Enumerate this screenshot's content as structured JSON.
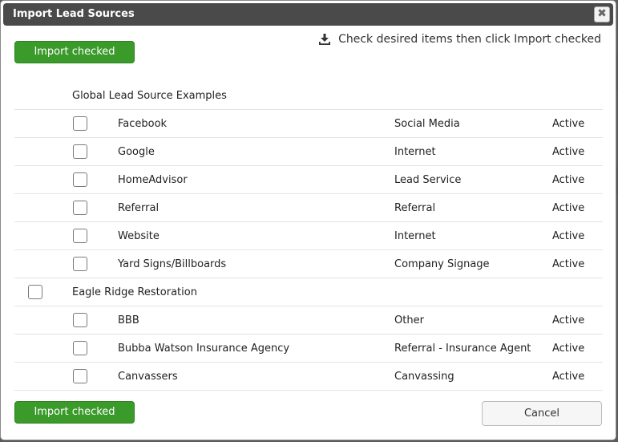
{
  "dialog": {
    "title": "Import Lead Sources",
    "close_label": "✖",
    "hint": "Check desired items then click Import checked",
    "import_label": "Import checked",
    "cancel_label": "Cancel"
  },
  "groups": [
    {
      "name": "Global Lead Source Examples",
      "has_checkbox": false,
      "items": [
        {
          "name": "Facebook",
          "type": "Social Media",
          "status": "Active"
        },
        {
          "name": "Google",
          "type": "Internet",
          "status": "Active"
        },
        {
          "name": "HomeAdvisor",
          "type": "Lead Service",
          "status": "Active"
        },
        {
          "name": "Referral",
          "type": "Referral",
          "status": "Active"
        },
        {
          "name": "Website",
          "type": "Internet",
          "status": "Active"
        },
        {
          "name": "Yard Signs/Billboards",
          "type": "Company Signage",
          "status": "Active"
        }
      ]
    },
    {
      "name": "Eagle Ridge Restoration",
      "has_checkbox": true,
      "items": [
        {
          "name": "BBB",
          "type": "Other",
          "status": "Active"
        },
        {
          "name": "Bubba Watson Insurance Agency",
          "type": "Referral - Insurance Agent",
          "status": "Active"
        },
        {
          "name": "Canvassers",
          "type": "Canvassing",
          "status": "Active"
        }
      ]
    }
  ]
}
